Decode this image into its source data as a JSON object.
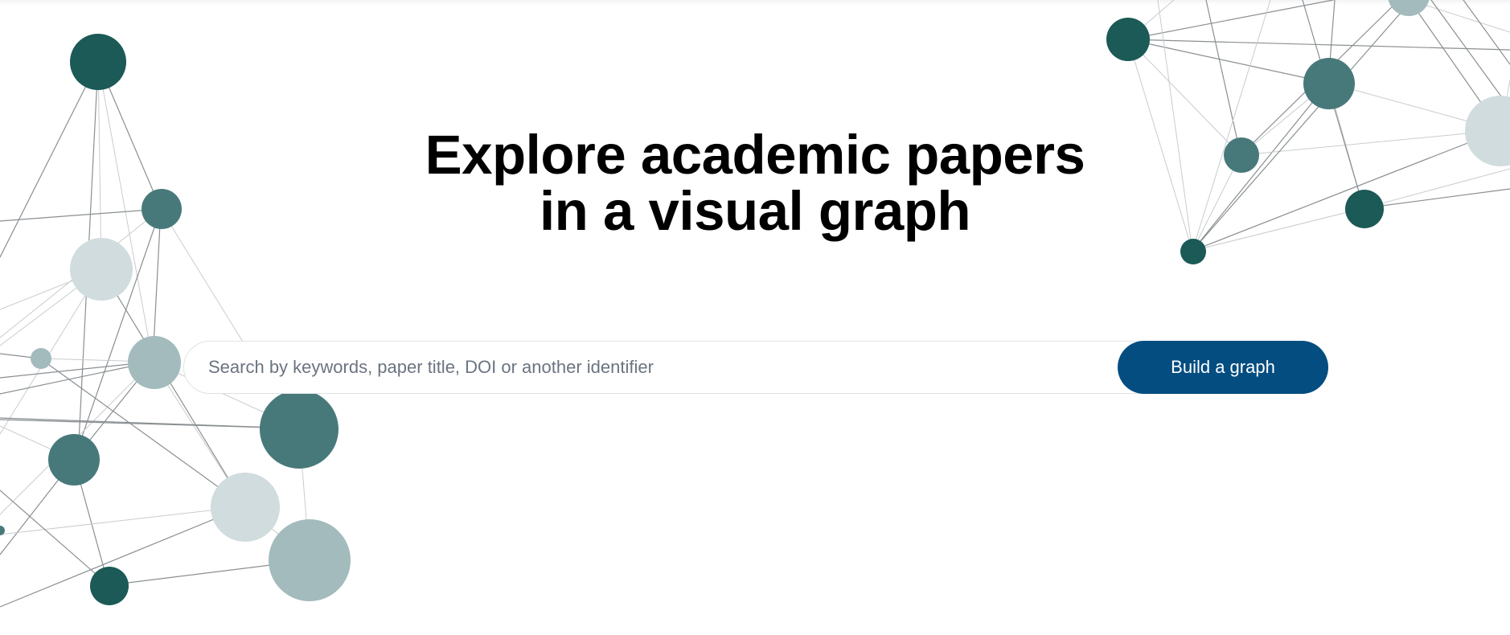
{
  "hero": {
    "title_line_1": "Explore academic papers",
    "title_line_2": "in a visual graph"
  },
  "search": {
    "placeholder": "Search by keywords, paper title, DOI or another identifier",
    "value": "",
    "button_label": "Build a graph"
  },
  "colors": {
    "button_bg": "#034d80",
    "node_dark": "#1b5a56",
    "node_mid": "#48797a",
    "node_light": "#a3bbbc",
    "node_pale": "#d0dcdd"
  }
}
